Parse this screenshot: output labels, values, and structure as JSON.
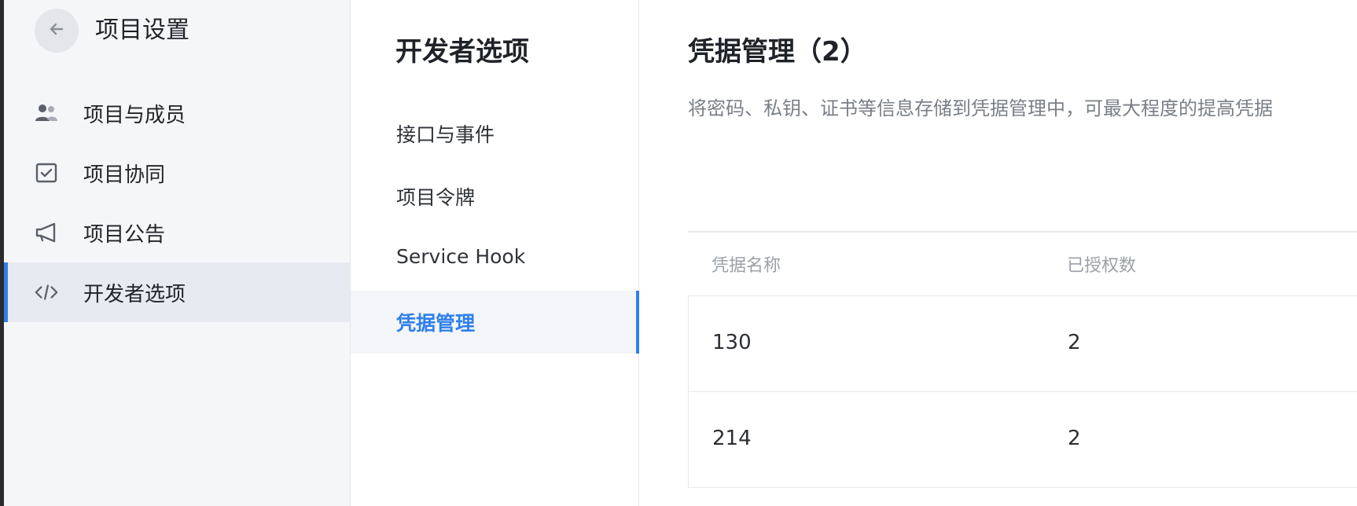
{
  "sidebar": {
    "title": "项目设置",
    "back_icon": "arrow-left-icon",
    "items": [
      {
        "label": "项目与成员",
        "icon": "members-icon"
      },
      {
        "label": "项目协同",
        "icon": "checkbox-icon"
      },
      {
        "label": "项目公告",
        "icon": "megaphone-icon"
      },
      {
        "label": "开发者选项",
        "icon": "code-icon",
        "active": true
      }
    ]
  },
  "subnav": {
    "title": "开发者选项",
    "items": [
      {
        "label": "接口与事件"
      },
      {
        "label": "项目令牌"
      },
      {
        "label": "Service Hook"
      },
      {
        "label": "凭据管理",
        "active": true
      }
    ]
  },
  "main": {
    "title": "凭据管理（2）",
    "description": "将密码、私钥、证书等信息存储到凭据管理中，可最大程度的提高凭据",
    "table": {
      "headers": [
        "凭据名称",
        "已授权数"
      ],
      "rows": [
        [
          "130",
          "2"
        ],
        [
          "214",
          "2"
        ]
      ]
    }
  },
  "colors": {
    "accent": "#2f80ed",
    "sidebar_bg": "#f5f6f8",
    "active_bg": "#e7eaf0"
  }
}
